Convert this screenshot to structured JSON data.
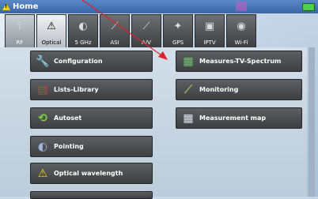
{
  "window": {
    "title": "Home"
  },
  "tabs": [
    {
      "label": "RF",
      "icon": "antenna-icon"
    },
    {
      "label": "Optical",
      "icon": "warning-icon"
    },
    {
      "label": "5 GHz",
      "icon": "dish-icon"
    },
    {
      "label": "ASI",
      "icon": "cable-icon"
    },
    {
      "label": "A/V",
      "icon": "probe-icon"
    },
    {
      "label": "GPS",
      "icon": "satellite-icon"
    },
    {
      "label": "IPTV",
      "icon": "monitor-icon"
    },
    {
      "label": "Wi-Fi",
      "icon": "wifi-icon"
    }
  ],
  "menu": {
    "configuration": "Configuration",
    "lists_library": "Lists-Library",
    "autoset": "Autoset",
    "pointing": "Pointing",
    "optical_wavelength": "Optical wavelength",
    "measures_tv_spectrum": "Measures-TV-Spectrum",
    "monitoring": "Monitoring",
    "measurement_map": "Measurement map"
  },
  "colors": {
    "titlebar": "#3a66a8",
    "button_bg": "#4a4c4f",
    "annotation_arrow": "#e0202a",
    "warning": "#f5d20a"
  }
}
